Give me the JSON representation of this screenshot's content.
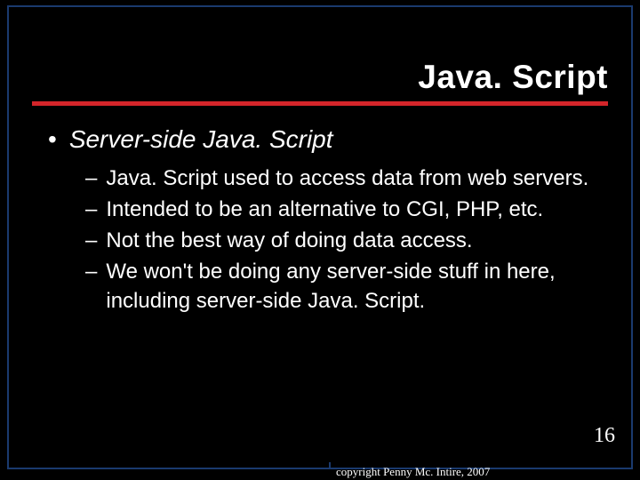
{
  "slide": {
    "title": "Java. Script",
    "bullet1": {
      "marker": "•",
      "text": "Server-side Java. Script"
    },
    "subBullets": [
      {
        "marker": "–",
        "text": "Java. Script used to access data from web servers."
      },
      {
        "marker": "–",
        "text": "Intended to be an alternative to CGI, PHP, etc."
      },
      {
        "marker": "–",
        "text": "Not the best way of doing data access."
      },
      {
        "marker": "–",
        "text": "We won't be doing any server-side stuff in here, including server-side Java. Script."
      }
    ],
    "pageNumber": "16",
    "copyright": "copyright Penny Mc. Intire, 2007"
  }
}
